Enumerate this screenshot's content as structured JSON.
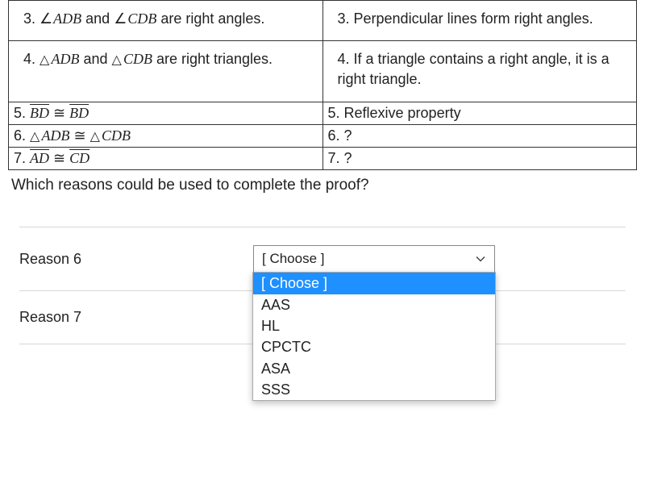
{
  "proof_rows": [
    {
      "num": "3.",
      "stmt_html": "<span class='angle math'>ADB</span> and <span class='angle math'>CDB</span> are right angles.",
      "reason": "3. Perpendicular lines form right angles.",
      "tall": true
    },
    {
      "num": "4.",
      "stmt_html": "<span class='tri math'>ADB</span> and <span class='tri math'>CDB</span> are right triangles.",
      "reason": "4. If a triangle contains a right angle, it is a right triangle.",
      "tall": true
    },
    {
      "num": "5.",
      "stmt_html": "<span class='overline'>BD</span> <span class='cong'>≅</span> <span class='overline'>BD</span>",
      "reason": "5. Reflexive property",
      "tall": false
    },
    {
      "num": "6.",
      "stmt_html": "<span class='tri math'>ADB</span> <span class='cong'>≅</span> <span class='tri math'>CDB</span>",
      "reason": "6.  ?",
      "tall": false
    },
    {
      "num": "7.",
      "stmt_html": "<span class='overline'>AD</span> <span class='cong'>≅</span> <span class='overline'>CD</span>",
      "reason": "7.  ?",
      "tall": false
    }
  ],
  "question": "Which reasons could be used to complete the proof?",
  "reason6_label": "Reason 6",
  "reason7_label": "Reason 7",
  "select_placeholder": "[ Choose ]",
  "dropdown_options": [
    "[ Choose ]",
    "AAS",
    "HL",
    "CPCTC",
    "ASA",
    "SSS"
  ]
}
